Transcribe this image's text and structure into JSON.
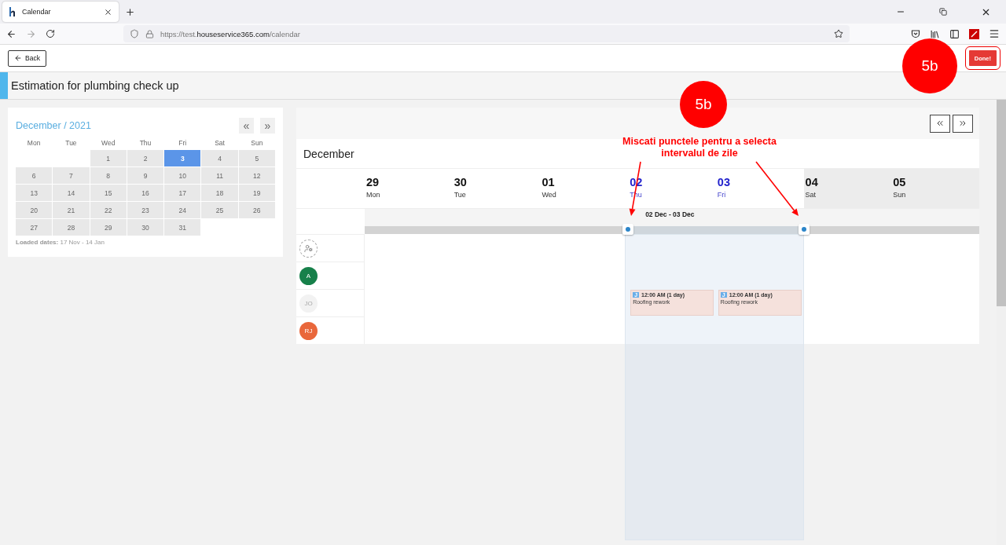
{
  "browser": {
    "tab_title": "Calendar",
    "url": {
      "prefix": "https://test.",
      "domain": "houseservice365.com",
      "path": "/calendar"
    }
  },
  "header": {
    "back_label": "Back",
    "done_label": "Done!"
  },
  "title": "Estimation for plumbing check up",
  "mini_calendar": {
    "title": "December / 2021",
    "prev": "«",
    "next": "»",
    "weekdays": [
      "Mon",
      "Tue",
      "Wed",
      "Thu",
      "Fri",
      "Sat",
      "Sun"
    ],
    "weeks": [
      [
        {
          "kind": "blank"
        },
        {
          "kind": "blank"
        },
        {
          "kind": "day",
          "day": "1",
          "selected": false
        },
        {
          "kind": "day",
          "day": "2",
          "selected": false
        },
        {
          "kind": "day",
          "day": "3",
          "selected": true
        },
        {
          "kind": "day",
          "day": "4",
          "selected": false
        },
        {
          "kind": "day",
          "day": "5",
          "selected": false
        }
      ],
      [
        {
          "kind": "day",
          "day": "6",
          "selected": false
        },
        {
          "kind": "day",
          "day": "7",
          "selected": false
        },
        {
          "kind": "day",
          "day": "8",
          "selected": false
        },
        {
          "kind": "day",
          "day": "9",
          "selected": false
        },
        {
          "kind": "day",
          "day": "10",
          "selected": false
        },
        {
          "kind": "day",
          "day": "11",
          "selected": false
        },
        {
          "kind": "day",
          "day": "12",
          "selected": false
        }
      ],
      [
        {
          "kind": "day",
          "day": "13",
          "selected": false
        },
        {
          "kind": "day",
          "day": "14",
          "selected": false
        },
        {
          "kind": "day",
          "day": "15",
          "selected": false
        },
        {
          "kind": "day",
          "day": "16",
          "selected": false
        },
        {
          "kind": "day",
          "day": "17",
          "selected": false
        },
        {
          "kind": "day",
          "day": "18",
          "selected": false
        },
        {
          "kind": "day",
          "day": "19",
          "selected": false
        }
      ],
      [
        {
          "kind": "day",
          "day": "20",
          "selected": false
        },
        {
          "kind": "day",
          "day": "21",
          "selected": false
        },
        {
          "kind": "day",
          "day": "22",
          "selected": false
        },
        {
          "kind": "day",
          "day": "23",
          "selected": false
        },
        {
          "kind": "day",
          "day": "24",
          "selected": false
        },
        {
          "kind": "day",
          "day": "25",
          "selected": false
        },
        {
          "kind": "day",
          "day": "26",
          "selected": false
        }
      ],
      [
        {
          "kind": "day",
          "day": "27",
          "selected": false
        },
        {
          "kind": "day",
          "day": "28",
          "selected": false
        },
        {
          "kind": "day",
          "day": "29",
          "selected": false
        },
        {
          "kind": "day",
          "day": "30",
          "selected": false
        },
        {
          "kind": "day",
          "day": "31",
          "selected": false
        },
        {
          "kind": "blank"
        },
        {
          "kind": "blank"
        }
      ]
    ],
    "footer": "**Loaded dates:** 17 Nov - 14 Jan"
  },
  "scheduler": {
    "month": "December",
    "days": [
      {
        "date": "29",
        "weekday": "Mon",
        "selected": false,
        "weekend": false
      },
      {
        "date": "30",
        "weekday": "Tue",
        "selected": false,
        "weekend": false
      },
      {
        "date": "01",
        "weekday": "Wed",
        "selected": false,
        "weekend": false
      },
      {
        "date": "02",
        "weekday": "Thu",
        "selected": true,
        "weekend": false
      },
      {
        "date": "03",
        "weekday": "Fri",
        "selected": true,
        "weekend": false
      },
      {
        "date": "04",
        "weekday": "Sat",
        "selected": false,
        "weekend": true
      },
      {
        "date": "05",
        "weekday": "Sun",
        "selected": false,
        "weekend": true
      }
    ],
    "range_label": "02 Dec - 03 Dec",
    "resources": [
      {
        "kind": "unassigned"
      },
      {
        "kind": "person",
        "initials": "A",
        "color": "#17804a",
        "disabled": false
      },
      {
        "kind": "person",
        "initials": "JO",
        "color": "#f2f2f2",
        "disabled": true,
        "cells": [
          {
            "kind": "empty"
          },
          {
            "kind": "empty"
          },
          {
            "kind": "empty"
          },
          {
            "kind": "event",
            "badge": "J",
            "time": "12:00 AM (1 day)",
            "title": "Roofing rework"
          },
          {
            "kind": "event",
            "badge": "J",
            "time": "12:00 AM (1 day)",
            "title": "Roofing rework"
          },
          {
            "kind": "empty"
          },
          {
            "kind": "empty"
          }
        ]
      },
      {
        "kind": "person",
        "initials": "RJ",
        "color": "#e9673b",
        "disabled": false
      }
    ]
  },
  "annotations": [
    {
      "kind": "badge",
      "text": "5b"
    },
    {
      "kind": "badge",
      "text": "5b"
    },
    {
      "kind": "callout",
      "text": "Miscati punctele pentru a selecta intervalul de zile"
    }
  ]
}
